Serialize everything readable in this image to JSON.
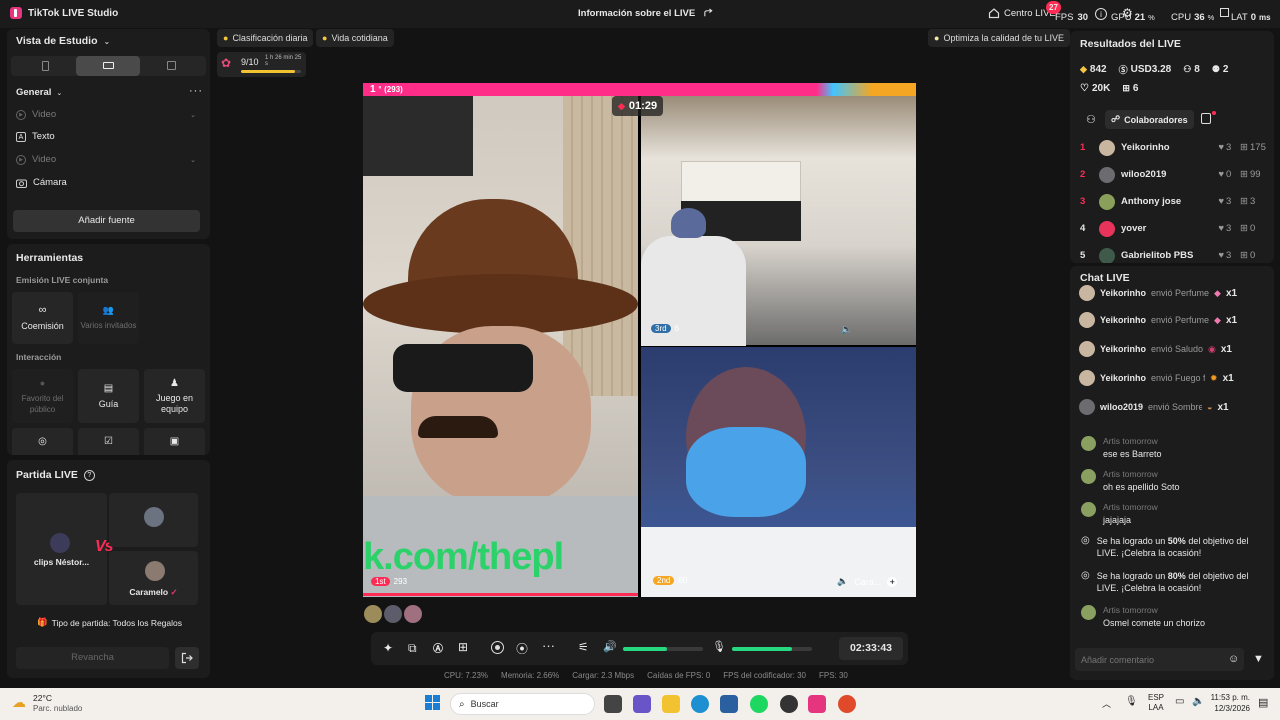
{
  "titlebar": {
    "app_name": "TikTok LIVE Studio",
    "center_title": "Información sobre el LIVE",
    "centro_label": "Centro LIVE",
    "fps_badge": "27",
    "fps_label": "FPS",
    "fps_value": "30",
    "gpu_label": "GPU",
    "gpu_value": "21",
    "gpu_unit": "%",
    "cpu_label": "CPU",
    "cpu_value": "36",
    "cpu_unit": "%",
    "lat_label": "LAT",
    "lat_value": "0",
    "lat_unit": "ms"
  },
  "left": {
    "studio_view": "Vista de Estudio",
    "general": "General",
    "sources": [
      "Video",
      "Texto",
      "Video",
      "Cámara"
    ],
    "add_source": "Añadir fuente",
    "tools_title": "Herramientas",
    "cohost_section": "Emisión LIVE conjunta",
    "cohost": "Coemisión",
    "multi_guest": "Varios invitados",
    "interaction_section": "Interacción",
    "favorite": "Favorito del público",
    "guide": "Guía",
    "team_game": "Juego en equipo",
    "match_title": "Partida LIVE",
    "player_left": "clips Néstor...",
    "vs": "Vs",
    "player_right": "Caramelo",
    "match_type": "Tipo de partida: Todos los Regalos",
    "rematch": "Revancha"
  },
  "center": {
    "tag_daily": "Clasificación diaria",
    "tag_life": "Vida cotidiana",
    "optimize": "Optimiza la calidad de tu LIVE",
    "progress_text": "9/10",
    "progress_time": "1 h 26 min 25 s",
    "progress_fraction": 0.9,
    "rank_badge": "1",
    "rank_badge_suffix": "º",
    "rank_score": "(293)",
    "timer": "01:29",
    "overlay_text": "k.com/thepl",
    "q1_badge": "1st",
    "q1_score": "293",
    "q2_badge": "3rd",
    "q2_score": "6",
    "q3_badge": "2nd",
    "q3_score": "60",
    "q3_name": "Cara...",
    "elapsed": "02:33:43",
    "speaker_level": 0.55,
    "mic_level": 0.75
  },
  "stats": {
    "cpu": "CPU:  7.23%",
    "memory": "Memoria:  2.66%",
    "upload": "Cargar:  2.3 Mbps",
    "fps_drop": "Caídas de FPS:  0",
    "encoder_fps": "FPS del codificador:  30",
    "fps": "FPS:  30"
  },
  "results": {
    "title": "Resultados del LIVE",
    "diamonds": "842",
    "usd": "USD3.28",
    "followers": "8",
    "shares": "2",
    "likes": "20K",
    "gifts": "6",
    "collab_label": "Colaboradores",
    "ranking": [
      {
        "rank": "1",
        "name": "Yeikorinho",
        "likes": "3",
        "gifts": "175"
      },
      {
        "rank": "2",
        "name": "wiloo2019",
        "likes": "0",
        "gifts": "99"
      },
      {
        "rank": "3",
        "name": "Anthony jose",
        "likes": "3",
        "gifts": "3"
      },
      {
        "rank": "4",
        "name": "yover",
        "likes": "3",
        "gifts": "0"
      },
      {
        "rank": "5",
        "name": "Gabrielitob PBS",
        "likes": "3",
        "gifts": "0"
      }
    ]
  },
  "chat": {
    "title": "Chat LIVE",
    "gift_rows": [
      {
        "user": "Yeikorinho",
        "action": "envió Perfume",
        "count": "x1"
      },
      {
        "user": "Yeikorinho",
        "action": "envió Perfume",
        "count": "x1"
      },
      {
        "user": "Yeikorinho",
        "action": "envió Saludo perso",
        "count": "x1"
      },
      {
        "user": "Yeikorinho",
        "action": "envió Fuego furios",
        "count": "x1"
      },
      {
        "user": "wiloo2019",
        "action": "envió Sombrero y",
        "count": "x1"
      }
    ],
    "msg1_user": "Artis tomorrow",
    "msg1_text": "ese es Barreto",
    "msg2_user": "Artis tomorrow",
    "msg2_text": "oh es apellido Soto",
    "msg3_user": "Artis tomorrow",
    "msg3_text": "jajajaja",
    "sys1_pre": "Se ha logrado un ",
    "sys1_pct": "50%",
    "sys1_post": " del objetivo del LIVE. ¡Celebra la ocasión!",
    "sys2_pre": "Se ha logrado un ",
    "sys2_pct": "80%",
    "sys2_post": " del objetivo del LIVE. ¡Celebra la ocasión!",
    "msg4_user": "Artis tomorrow",
    "msg4_text": "Osmel comete un chorizo",
    "input_placeholder": "Añadir comentario"
  },
  "taskbar": {
    "temp": "22°C",
    "weather": "Parc. nublado",
    "search": "Buscar",
    "lang1": "ESP",
    "lang2": "LAA",
    "time": "11:53 p. m.",
    "date": "12/3/2026"
  },
  "colors": {
    "accent_pink": "#fe2c55",
    "accent_green": "#26d97f",
    "tiktok_pink": "#e5357f"
  }
}
